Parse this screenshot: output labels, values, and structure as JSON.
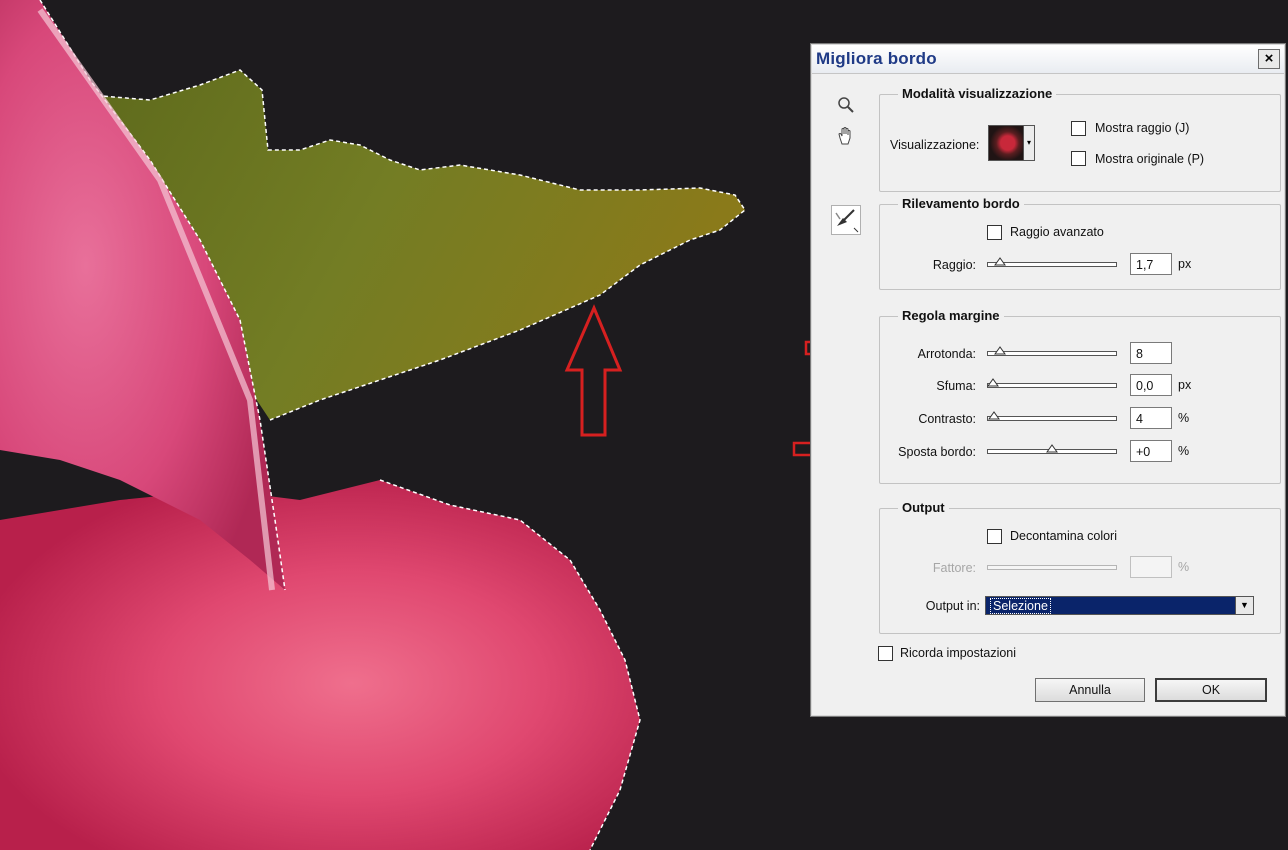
{
  "dialog": {
    "title": "Migliora bordo",
    "close_label": "×",
    "view_mode": {
      "legend": "Modalità visualizzazione",
      "view_label": "Visualizzazione:",
      "show_radius_label": "Mostra raggio (J)",
      "show_original_label": "Mostra originale (P)"
    },
    "edge_detection": {
      "legend": "Rilevamento bordo",
      "smart_radius_label": "Raggio avanzato",
      "radius_label": "Raggio:",
      "radius_value": "1,7",
      "radius_unit": "px"
    },
    "adjust_edge": {
      "legend": "Regola margine",
      "smooth_label": "Arrotonda:",
      "smooth_value": "8",
      "feather_label": "Sfuma:",
      "feather_value": "0,0",
      "feather_unit": "px",
      "contrast_label": "Contrasto:",
      "contrast_value": "4",
      "contrast_unit": "%",
      "shift_label": "Sposta bordo:",
      "shift_value": "+0",
      "shift_unit": "%"
    },
    "output": {
      "legend": "Output",
      "decontaminate_label": "Decontamina colori",
      "amount_label": "Fattore:",
      "amount_value": "",
      "amount_unit": "%",
      "output_to_label": "Output in:",
      "output_to_value": "Selezione"
    },
    "remember_label": "Ricorda impostazioni",
    "cancel_label": "Annulla",
    "ok_label": "OK"
  },
  "colors": {
    "annotation_arrow": "#d62020",
    "title_text": "#1f3a86",
    "select_bg": "#0a246a"
  },
  "icons": [
    "zoom-icon",
    "hand-icon",
    "refine-radius-brush-icon",
    "dropdown-arrow-icon"
  ]
}
